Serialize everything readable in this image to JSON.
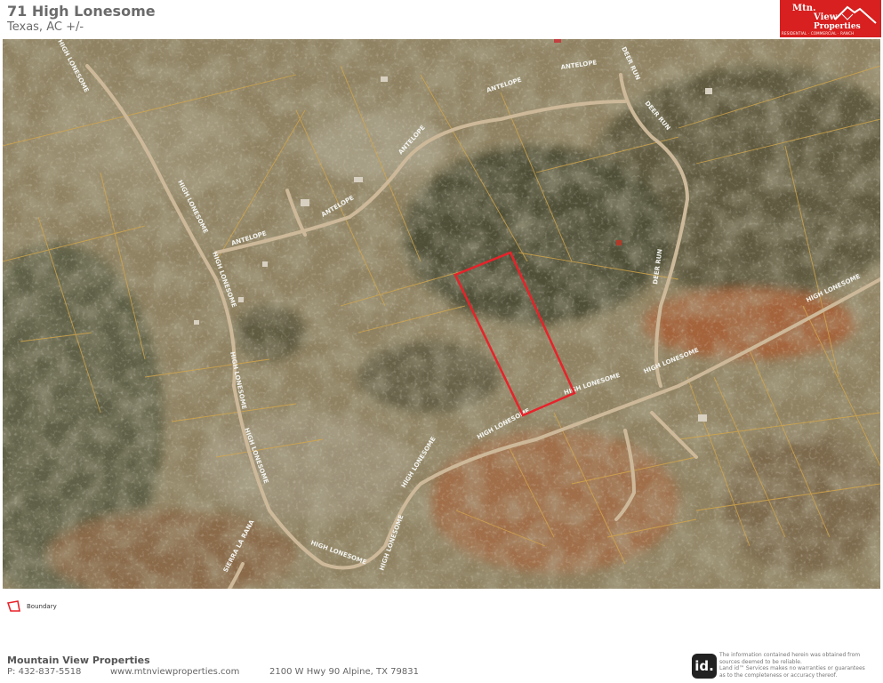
{
  "header": {
    "title": "71 High Lonesome",
    "subtitle": "Texas,  AC +/-"
  },
  "logo": {
    "line1": "Mtn.",
    "line2": "View",
    "line3": "Properties",
    "tagline": "RESIDENTIAL · COMMERCIAL · RANCH"
  },
  "map": {
    "boundary_color": "#e8222a",
    "parcel_line_color": "#d4a64a",
    "road_labels": {
      "antelope_1": "ANTELOPE",
      "antelope_2": "ANTELOPE",
      "antelope_3": "ANTELOPE",
      "antelope_4": "ANTELOPE",
      "deer_run_1": "DEER RUN",
      "deer_run_2": "DEER RUN",
      "deer_run_3": "DEER RUN",
      "hl_1": "HIGH LONESOME",
      "hl_2": "HIGH LONESOME",
      "hl_3": "HIGH LONESOME",
      "hl_4": "HIGH LONESOME",
      "hl_5": "HIGH LONESOME",
      "hl_6": "HIGH LONESOME",
      "hl_7": "HIGH LONESOME",
      "hl_8": "HIGH LONESOME",
      "hl_9": "HIGH LONESOME",
      "hl_10": "HIGH LONESOME",
      "hl_11": "HIGH LONESOME",
      "sierra": "SIERRA LA RANA"
    },
    "scale": {
      "ticks": [
        "0",
        "500",
        "1000",
        "1500",
        "2000ft"
      ]
    }
  },
  "legend": {
    "label": "Boundary"
  },
  "footer": {
    "company": "Mountain View Properties",
    "phone": "P: 432-837-5518",
    "website": "www.mtnviewproperties.com",
    "address": "2100 W Hwy 90 Alpine, TX 79831",
    "id_logo": "id.",
    "disclaimer_1": "The information contained herein was obtained from",
    "disclaimer_2": "sources deemed to be reliable.",
    "disclaimer_3": "Land id™ Services makes no warranties or guarantees",
    "disclaimer_4": "as to the completeness or accuracy thereof."
  }
}
